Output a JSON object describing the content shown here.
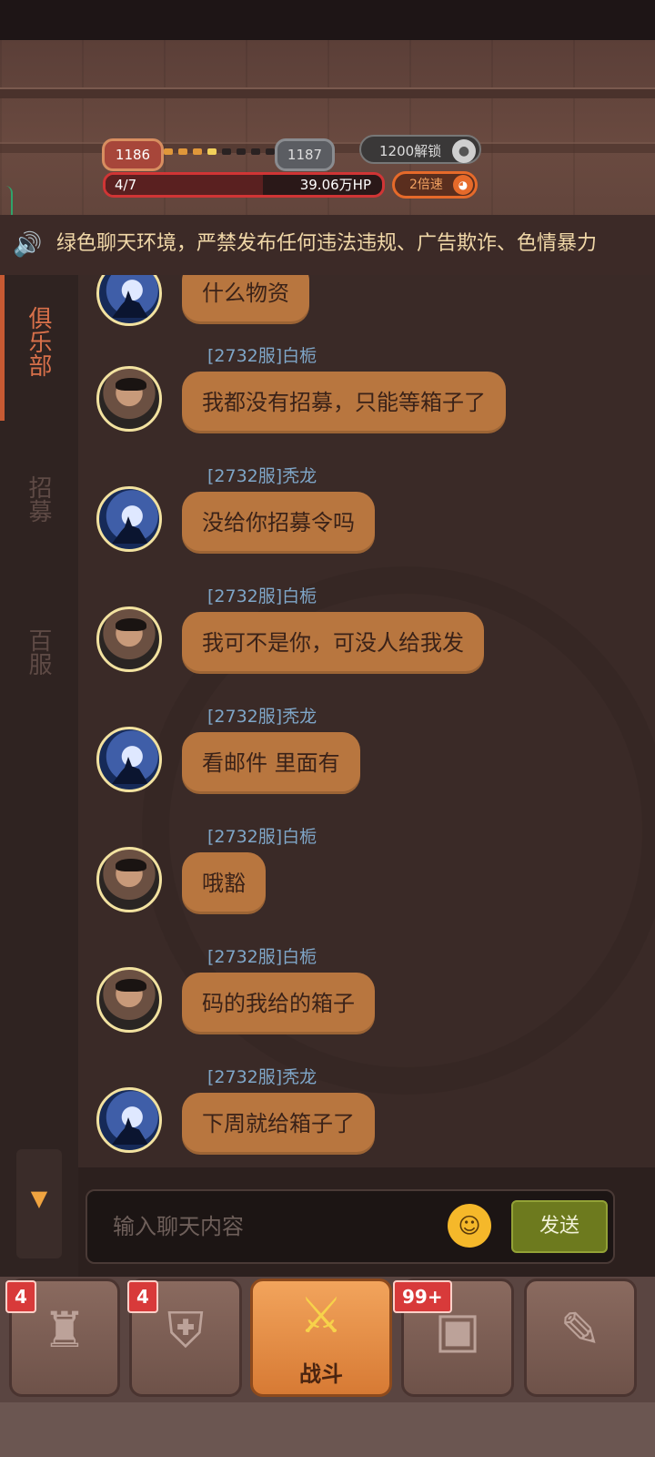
{
  "hud": {
    "current_level": "1186",
    "next_level": "1187",
    "unlock_label": "1200解锁",
    "stage": "4/7",
    "stage_progress": 0.57,
    "hp": "39.06万HP",
    "speed_label": "2倍速"
  },
  "notice": {
    "text": "绿色聊天环境，严禁发布任何违法违规、广告欺诈、色情暴力"
  },
  "side_tabs": [
    {
      "label": "俱乐部",
      "active": true
    },
    {
      "label": "招募",
      "active": false
    },
    {
      "label": "百服",
      "active": false
    }
  ],
  "messages": [
    {
      "sender": "",
      "text": "什么物资",
      "avatar": "wolf-avatar"
    },
    {
      "sender": "[2732服]白栀",
      "text": "我都没有招募，只能等箱子了",
      "avatar": "face-avatar"
    },
    {
      "sender": "[2732服]秃龙",
      "text": "没给你招募令吗",
      "avatar": "wolf-avatar"
    },
    {
      "sender": "[2732服]白栀",
      "text": "我可不是你，可没人给我发",
      "avatar": "face-avatar"
    },
    {
      "sender": "[2732服]秃龙",
      "text": "看邮件 里面有",
      "avatar": "wolf-avatar"
    },
    {
      "sender": "[2732服]白栀",
      "text": "哦豁",
      "avatar": "face-avatar"
    },
    {
      "sender": "[2732服]白栀",
      "text": "码的我给的箱子",
      "avatar": "face-avatar"
    },
    {
      "sender": "[2732服]秃龙",
      "text": "下周就给箱子了",
      "avatar": "wolf-avatar"
    }
  ],
  "input": {
    "placeholder": "输入聊天内容",
    "send_label": "发送"
  },
  "bottom_nav": [
    {
      "name": "hero",
      "icon": "helmet-icon",
      "badge": "4"
    },
    {
      "name": "equipment",
      "icon": "armor-icon",
      "badge": "4"
    },
    {
      "name": "battle",
      "icon": "crossed-axes-icon",
      "label": "战斗",
      "badge": ""
    },
    {
      "name": "chest",
      "icon": "chest-icon",
      "badge": "99+"
    },
    {
      "name": "map",
      "icon": "map-scroll-icon",
      "badge": ""
    }
  ],
  "colors": {
    "bubble": "#b8763f",
    "active_tab": "#d8704a",
    "sender_name": "#7fa6c8",
    "send_button": "#6d7a1e"
  }
}
